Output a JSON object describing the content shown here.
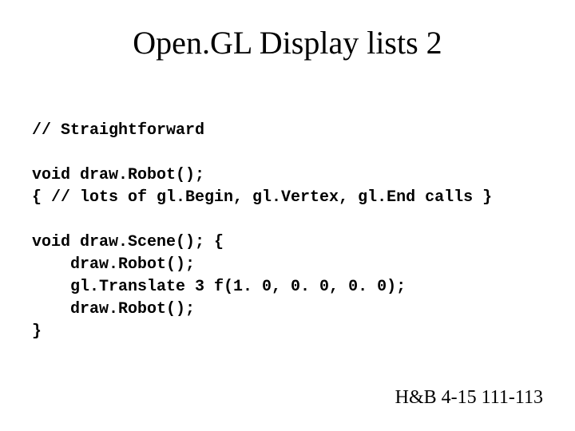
{
  "slide": {
    "title": "Open.GL Display lists 2",
    "code": "// Straightforward\n\nvoid draw.Robot();\n{ // lots of gl.Begin, gl.Vertex, gl.End calls }\n\nvoid draw.Scene(); {\n    draw.Robot();\n    gl.Translate 3 f(1. 0, 0. 0, 0. 0);\n    draw.Robot();\n}",
    "footer": "H&B 4-15 111-113"
  }
}
